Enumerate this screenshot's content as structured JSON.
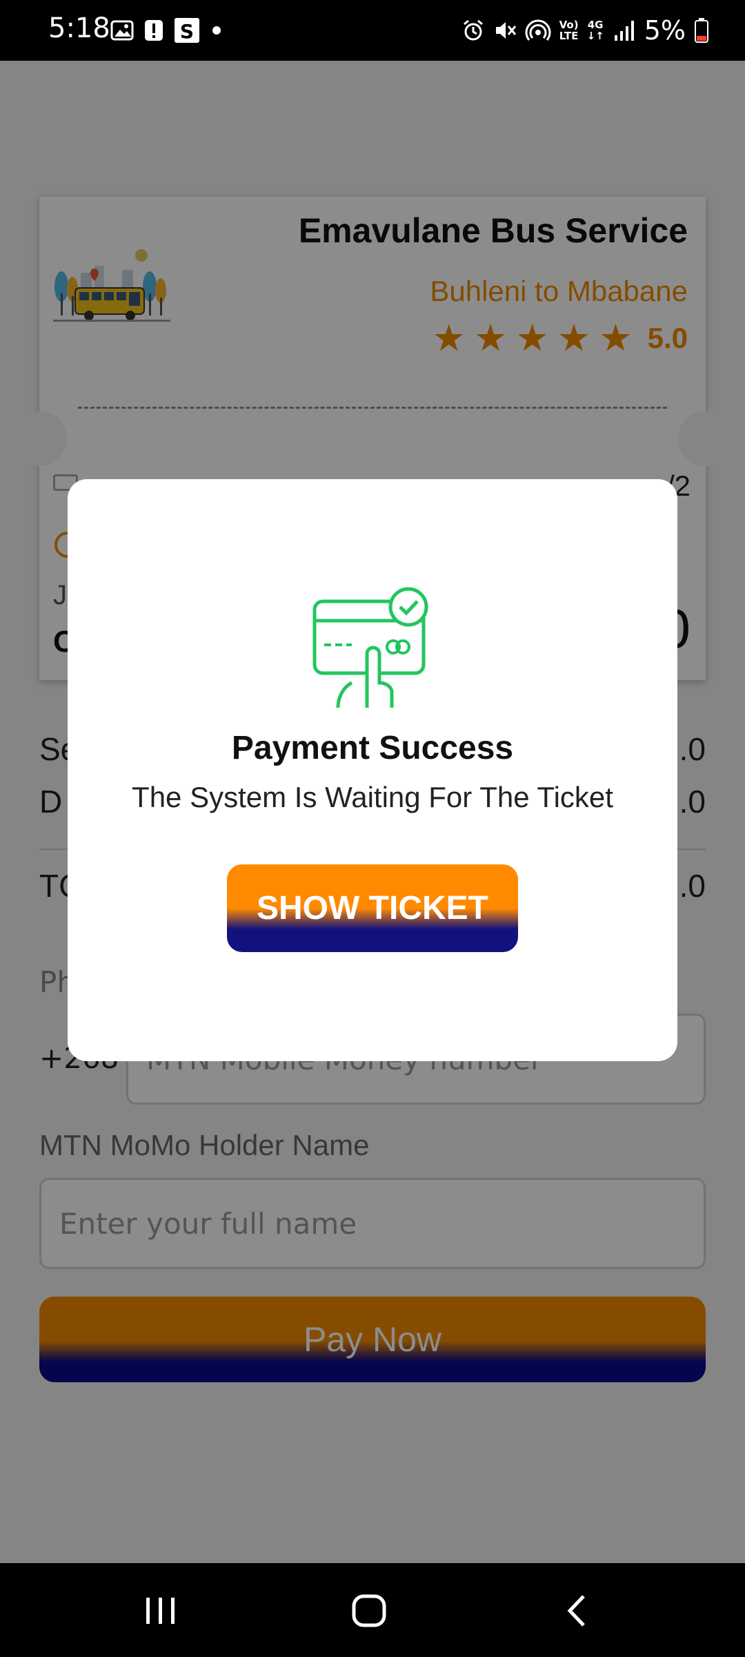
{
  "status_bar": {
    "time": "5:18",
    "battery": "5%",
    "network_lte": "LTE",
    "network_4g": "4G",
    "icons": [
      "image-icon",
      "alert-icon",
      "s-app-icon",
      "dot-icon",
      "alarm-icon",
      "mute-icon",
      "hotspot-icon",
      "volte-icon",
      "4g-icon",
      "signal-icon",
      "battery-icon"
    ]
  },
  "ticket": {
    "operator": "Emavulane Bus Service",
    "route": "Buhleni to Mbabane",
    "rating": "5.0",
    "stars": 5,
    "partial_right": "/2",
    "partial_left_1": "J",
    "partial_left_2": "C",
    "partial_price": "0"
  },
  "summary": {
    "row1_label": "Se",
    "row1_value": ".0",
    "row2_label": "D",
    "row2_value": ".0",
    "total_label": "TC",
    "total_value": ".0"
  },
  "form": {
    "phone_label": "Ph",
    "country_code": "+268",
    "phone_placeholder": "MTN Mobile Money number",
    "holder_label": "MTN MoMo Holder Name",
    "holder_placeholder": "Enter your full name",
    "pay_button": "Pay Now"
  },
  "modal": {
    "title": "Payment Success",
    "message": "The System Is Waiting For The Ticket",
    "button": "SHOW TICKET"
  },
  "colors": {
    "accent_orange": "#f08a00",
    "button_navy": "#12127f",
    "success_green": "#22c55e"
  }
}
